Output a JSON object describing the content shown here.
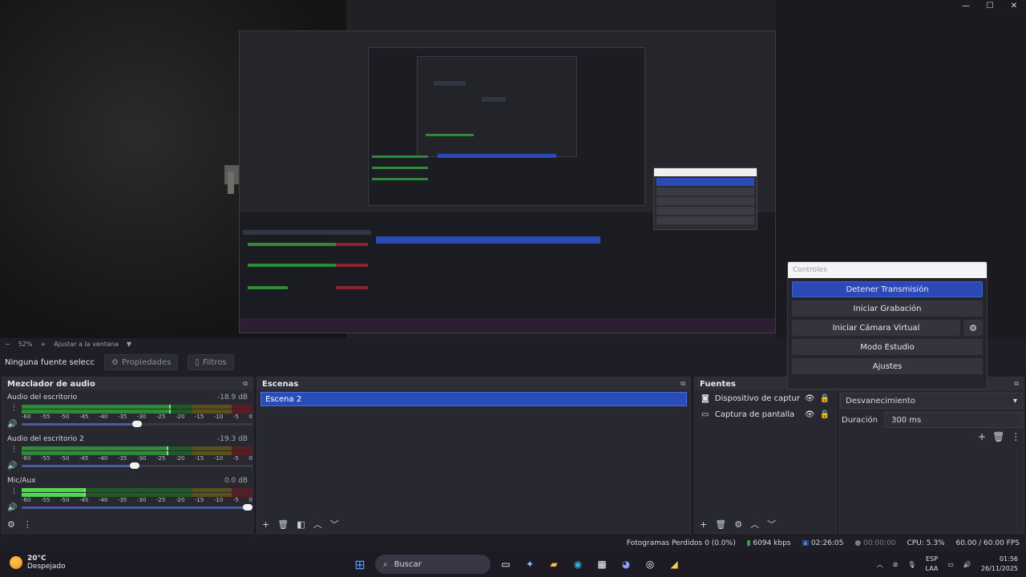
{
  "window": {
    "min": "—",
    "max": "☐",
    "close": "✕"
  },
  "preview": {
    "zoom": "52%",
    "zoom_minus": "−",
    "zoom_plus": "+",
    "fit": "Ajustar a la ventana"
  },
  "props": {
    "no_selection": "Ninguna fuente seleccionad",
    "properties": "Propiedades",
    "filters": "Filtros"
  },
  "mixer": {
    "title": "Mezclador de audio",
    "scale": [
      "-60",
      "-55",
      "-50",
      "-45",
      "-40",
      "-35",
      "-30",
      "-25",
      "-20",
      "-15",
      "-10",
      "-5",
      "0"
    ],
    "channels": [
      {
        "name": "Audio del escritorio",
        "db": "-18.9 dB",
        "level": 0.64,
        "volume": 0.5
      },
      {
        "name": "Audio del escritorio 2",
        "db": "-19.3 dB",
        "level": 0.63,
        "volume": 0.49
      },
      {
        "name": "Mic/Aux",
        "db": "0.0 dB",
        "level": 0.27,
        "volume": 1.0
      }
    ]
  },
  "scenes": {
    "title": "Escenas",
    "items": [
      "Escena 2"
    ]
  },
  "sources": {
    "title": "Fuentes",
    "items": [
      {
        "name": "Dispositivo de captura de vide",
        "icon": "camera-icon"
      },
      {
        "name": "Captura de pantalla",
        "icon": "monitor-icon"
      }
    ]
  },
  "transitions": {
    "selected": "Desvanecimiento",
    "duration_label": "Duración",
    "duration_value": "300 ms"
  },
  "controls": {
    "title": "Controles",
    "stop_stream": "Detener Transmisión",
    "start_rec": "Iniciar Grabación",
    "start_vcam": "Iniciar Cámara Virtual",
    "studio": "Modo Estudio",
    "settings": "Ajustes"
  },
  "status": {
    "dropped": "Fotogramas Perdidos 0 (0.0%)",
    "bitrate": "6094 kbps",
    "stream_time": "02:26:05",
    "rec_time": "00:00:00",
    "cpu": "CPU: 5.3%",
    "fps": "60.00 / 60.00 FPS"
  },
  "taskbar": {
    "temp": "20°C",
    "weather": "Despejado",
    "search": "Buscar",
    "lang1": "ESP",
    "lang2": "LAA",
    "time": "01:56",
    "date": "26/11/2025"
  },
  "colors": {
    "accent": "#2b4ab8",
    "meter_green": "#2f8a38",
    "meter_yellow": "#8a7a1e",
    "meter_red": "#8b2430"
  }
}
